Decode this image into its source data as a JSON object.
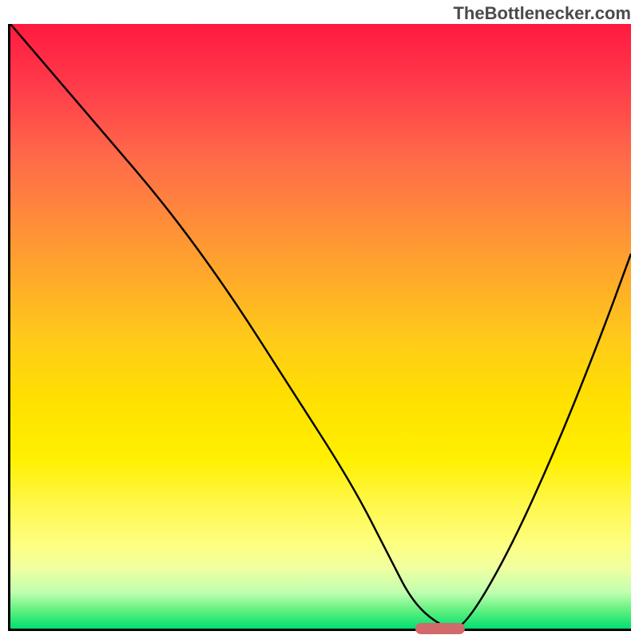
{
  "watermark": "TheBottlenecker.com",
  "chart_data": {
    "type": "line",
    "title": "",
    "xlabel": "",
    "ylabel": "",
    "xlim": [
      0,
      100
    ],
    "ylim": [
      0,
      100
    ],
    "series": [
      {
        "name": "bottleneck-curve",
        "x": [
          0,
          15,
          25,
          35,
          45,
          55,
          61,
          65,
          70,
          73,
          80,
          88,
          95,
          100
        ],
        "values": [
          100,
          82,
          70,
          56,
          40,
          24,
          12,
          4,
          0,
          0,
          12,
          30,
          48,
          62
        ]
      }
    ],
    "marker": {
      "x_start": 65,
      "x_end": 73,
      "y": 0
    },
    "gradient_stops": [
      {
        "pct": 0,
        "color": "#ff1a40"
      },
      {
        "pct": 50,
        "color": "#ffc800"
      },
      {
        "pct": 90,
        "color": "#f8ff70"
      },
      {
        "pct": 100,
        "color": "#00e070"
      }
    ]
  }
}
